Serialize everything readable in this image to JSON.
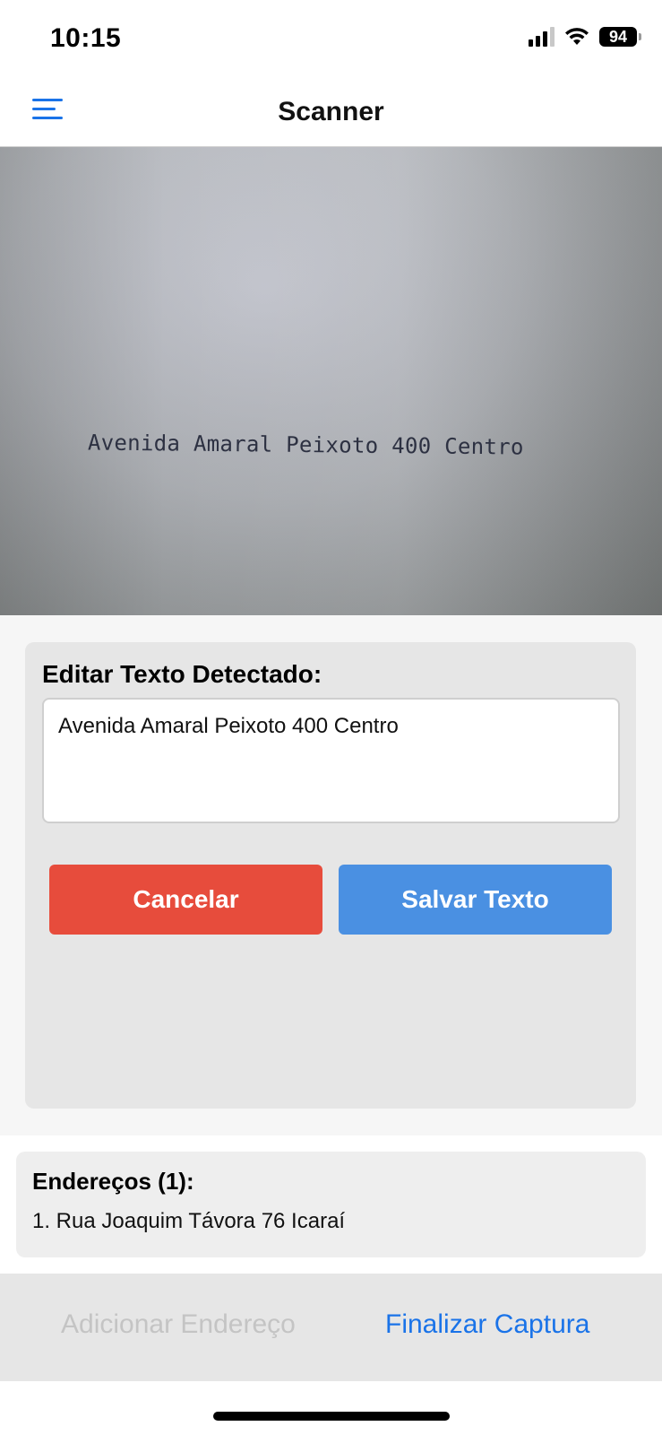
{
  "status_bar": {
    "time": "10:15",
    "battery": "94"
  },
  "nav": {
    "title": "Scanner"
  },
  "camera": {
    "detected_text": "Avenida Amaral Peixoto 400 Centro"
  },
  "editor": {
    "title": "Editar Texto Detectado:",
    "text_value": "Avenida Amaral Peixoto 400 Centro",
    "cancel_label": "Cancelar",
    "save_label": "Salvar Texto"
  },
  "addresses": {
    "title": "Endereços (1):",
    "items": [
      "1. Rua Joaquim Távora 76 Icaraí"
    ]
  },
  "bottom_bar": {
    "add_label": "Adicionar Endereço",
    "finish_label": "Finalizar Captura"
  },
  "colors": {
    "accent": "#1a73e8",
    "cancel": "#e74c3c",
    "save": "#4a90e2",
    "disabled": "#c4c4c4"
  },
  "icons": {
    "menu": "hamburger-menu-icon",
    "signal": "cellular-signal-icon",
    "wifi": "wifi-icon",
    "battery": "battery-icon"
  }
}
